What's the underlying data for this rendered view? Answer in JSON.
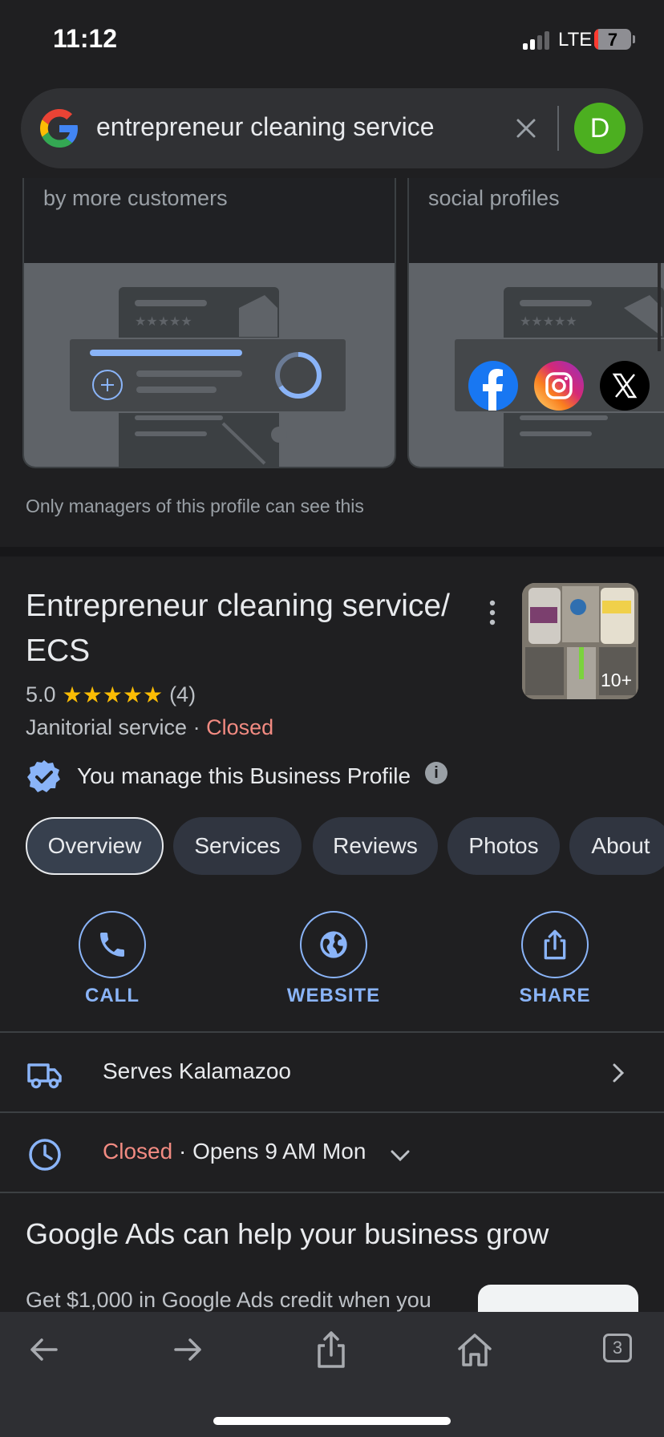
{
  "status_bar": {
    "time": "11:12",
    "network": "LTE",
    "battery": "7"
  },
  "search": {
    "query": "entrepreneur cleaning service",
    "avatar_letter": "D"
  },
  "promo_cards": [
    {
      "text": "by more customers"
    },
    {
      "text": "social profiles"
    }
  ],
  "managers_note": "Only managers of this profile can see this",
  "business": {
    "name": "Entrepreneur cleaning service/ ECS",
    "rating": "5.0",
    "stars": "★★★★★",
    "review_count": "(4)",
    "category": "Janitorial service",
    "separator": "·",
    "status": "Closed",
    "photo_count": "10+",
    "manage_text": "You manage this Business Profile"
  },
  "tabs": [
    "Overview",
    "Services",
    "Reviews",
    "Photos",
    "About"
  ],
  "actions": [
    {
      "label": "CALL",
      "icon": "phone-icon"
    },
    {
      "label": "WEBSITE",
      "icon": "globe-icon"
    },
    {
      "label": "SHARE",
      "icon": "share-icon"
    }
  ],
  "service_area": {
    "text": "Serves Kalamazoo"
  },
  "hours": {
    "status": "Closed",
    "separator": "·",
    "next": "Opens 9 AM Mon"
  },
  "ads": {
    "title": "Google Ads can help your business grow",
    "text": "Get $1,000 in Google Ads credit when you"
  },
  "toolbar": {
    "tab_count": "3"
  },
  "colors": {
    "accent": "#8ab4f8",
    "closed": "#f28b82",
    "star": "#fbbc04",
    "background": "#1f1f21"
  }
}
